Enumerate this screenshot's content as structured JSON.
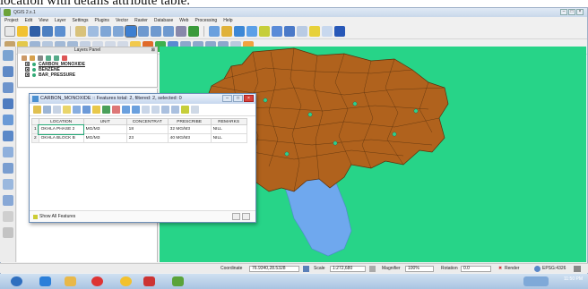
{
  "caption": "location with details attribute table.",
  "app": {
    "title": "QGIS 2.x.1",
    "menu": [
      "Project",
      "Edit",
      "View",
      "Layer",
      "Settings",
      "Plugins",
      "Vector",
      "Raster",
      "Database",
      "Web",
      "Processing",
      "Help"
    ]
  },
  "layers_panel": {
    "title": "Layers Panel",
    "layers": [
      {
        "name": "CARBON_MONOXIDE",
        "checked": "✖"
      },
      {
        "name": "BENZENE",
        "checked": "✖"
      },
      {
        "name": "BAR_PRESSURE",
        "checked": "✖"
      }
    ]
  },
  "attribute_table": {
    "title": "CARBON_MONOXIDE :: Features total: 2, filtered: 2, selected: 0",
    "columns": [
      "LOCATION",
      "UNIT",
      "CONCENTRAT",
      "PRESCRIBE",
      "REMARKS"
    ],
    "rows": [
      {
        "num": "1",
        "cells": [
          "OKHLA PHASE 2",
          "MG/M3",
          "18",
          "32 MG/M3",
          "NILL"
        ]
      },
      {
        "num": "2",
        "cells": [
          "OKHLA BLOCK B",
          "MG/M3",
          "23",
          "40 MG/M3",
          "NILL"
        ]
      }
    ],
    "footer_button": "Show All Features"
  },
  "statusbar": {
    "coordinate_label": "Coordinate",
    "coordinate_value": "76.9340,28.5328",
    "scale_label": "Scale",
    "scale_value": "1:272,680",
    "magnifier_label": "Magnifier",
    "magnifier_value": "100%",
    "rotation_label": "Rotation",
    "rotation_value": "0.0",
    "render_label": "Render",
    "crs_label": "EPSG:4326"
  },
  "taskbar": {
    "clock": "11:50 PM"
  },
  "colors": {
    "map_background": "#27d488",
    "region_fill": "#b0621d",
    "water_fill": "#6fa8ee"
  },
  "icons": [
    "new-project-icon",
    "open-project-icon",
    "save-icon",
    "print-icon",
    "pan-icon",
    "zoom-in-icon",
    "zoom-out-icon",
    "identify-icon",
    "select-icon",
    "measure-icon",
    "field-calculator-icon"
  ]
}
